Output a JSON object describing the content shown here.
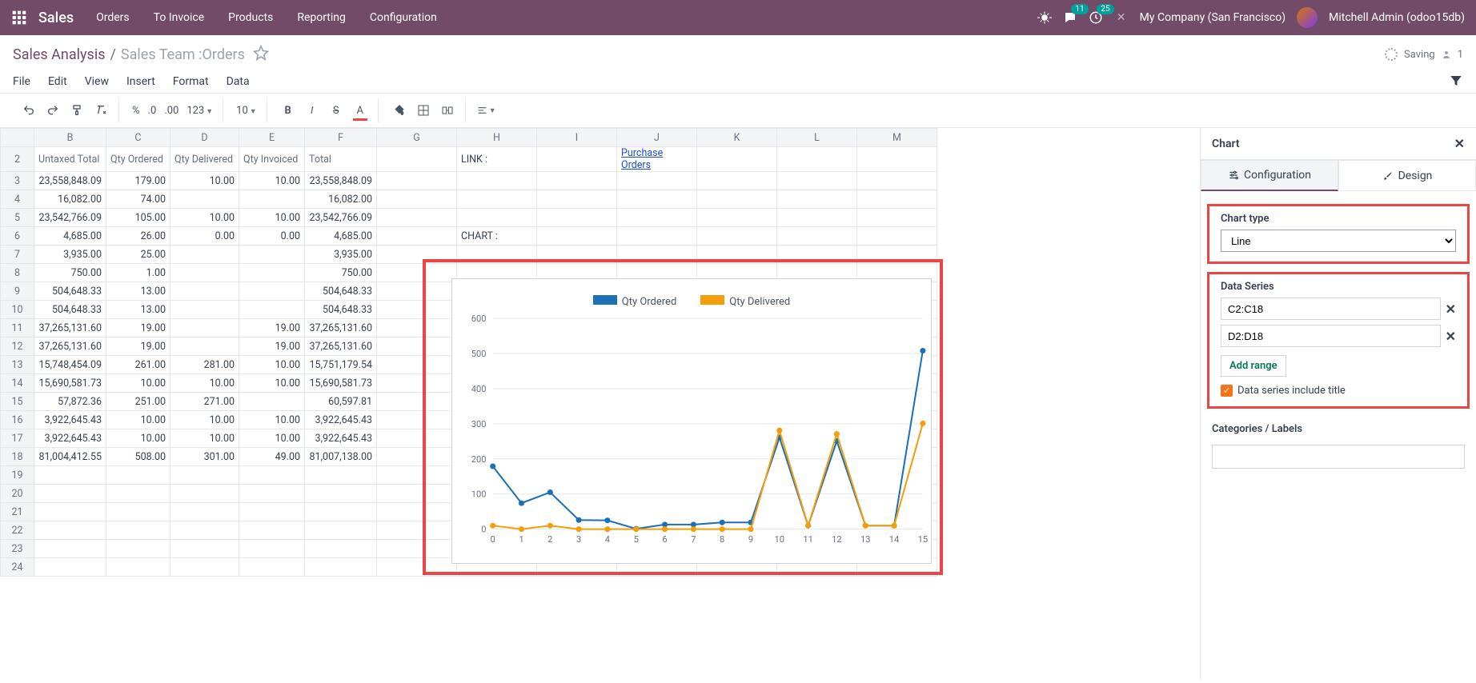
{
  "topnav": {
    "brand": "Sales",
    "menu": [
      "Orders",
      "To Invoice",
      "Products",
      "Reporting",
      "Configuration"
    ],
    "msg_count": "11",
    "activity_count": "25",
    "company": "My Company (San Francisco)",
    "user": "Mitchell Admin (odoo15db)"
  },
  "breadcrumb": {
    "root": "Sales Analysis",
    "current": "Sales Team :Orders",
    "saving": "Saving",
    "users": "1"
  },
  "menubar": [
    "File",
    "Edit",
    "View",
    "Insert",
    "Format",
    "Data"
  ],
  "toolbar": {
    "percent": "%",
    "d0": ".0",
    "d00": ".00",
    "n123": "123",
    "fontsize": "10",
    "bold": "B",
    "italic": "I",
    "strike": "S",
    "color": "A"
  },
  "sheet": {
    "col_letters": [
      "B",
      "C",
      "D",
      "E",
      "F",
      "G",
      "H",
      "I",
      "J",
      "K",
      "L",
      "M"
    ],
    "headers": [
      "Untaxed Total",
      "Qty Ordered",
      "Qty Delivered",
      "Qty Invoiced",
      "Total"
    ],
    "link_label": "LINK :",
    "link_text": "Purchase Orders",
    "chart_label": "CHART :",
    "rows": [
      {
        "n": 3,
        "c": [
          "23,558,848.09",
          "179.00",
          "10.00",
          "10.00",
          "23,558,848.09"
        ]
      },
      {
        "n": 4,
        "c": [
          "16,082.00",
          "74.00",
          "",
          "",
          "16,082.00"
        ]
      },
      {
        "n": 5,
        "c": [
          "23,542,766.09",
          "105.00",
          "10.00",
          "10.00",
          "23,542,766.09"
        ]
      },
      {
        "n": 6,
        "c": [
          "4,685.00",
          "26.00",
          "0.00",
          "0.00",
          "4,685.00"
        ]
      },
      {
        "n": 7,
        "c": [
          "3,935.00",
          "25.00",
          "",
          "",
          "3,935.00"
        ]
      },
      {
        "n": 8,
        "c": [
          "750.00",
          "1.00",
          "",
          "",
          "750.00"
        ]
      },
      {
        "n": 9,
        "c": [
          "504,648.33",
          "13.00",
          "",
          "",
          "504,648.33"
        ]
      },
      {
        "n": 10,
        "c": [
          "504,648.33",
          "13.00",
          "",
          "",
          "504,648.33"
        ]
      },
      {
        "n": 11,
        "c": [
          "37,265,131.60",
          "19.00",
          "",
          "19.00",
          "37,265,131.60"
        ]
      },
      {
        "n": 12,
        "c": [
          "37,265,131.60",
          "19.00",
          "",
          "19.00",
          "37,265,131.60"
        ]
      },
      {
        "n": 13,
        "c": [
          "15,748,454.09",
          "261.00",
          "281.00",
          "10.00",
          "15,751,179.54"
        ]
      },
      {
        "n": 14,
        "c": [
          "15,690,581.73",
          "10.00",
          "10.00",
          "10.00",
          "15,690,581.73"
        ]
      },
      {
        "n": 15,
        "c": [
          "57,872.36",
          "251.00",
          "271.00",
          "",
          "60,597.81"
        ]
      },
      {
        "n": 16,
        "c": [
          "3,922,645.43",
          "10.00",
          "10.00",
          "10.00",
          "3,922,645.43"
        ]
      },
      {
        "n": 17,
        "c": [
          "3,922,645.43",
          "10.00",
          "10.00",
          "10.00",
          "3,922,645.43"
        ]
      },
      {
        "n": 18,
        "c": [
          "81,004,412.55",
          "508.00",
          "301.00",
          "49.00",
          "81,007,138.00"
        ]
      }
    ],
    "empty_rows": [
      19,
      20,
      21,
      22,
      23,
      24
    ]
  },
  "chart_data": {
    "type": "line",
    "title": "",
    "xlabel": "",
    "ylabel": "",
    "ylim": [
      0,
      600
    ],
    "yticks": [
      0,
      100,
      200,
      300,
      400,
      500,
      600
    ],
    "x": [
      0,
      1,
      2,
      3,
      4,
      5,
      6,
      7,
      8,
      9,
      10,
      11,
      12,
      13,
      14,
      15
    ],
    "series": [
      {
        "name": "Qty Ordered",
        "color": "#1d6fb8",
        "values": [
          179,
          74,
          105,
          26,
          25,
          1,
          13,
          13,
          19,
          19,
          261,
          10,
          251,
          10,
          10,
          508
        ]
      },
      {
        "name": "Qty Delivered",
        "color": "#f59e0b",
        "values": [
          10,
          0,
          10,
          0,
          0,
          0,
          0,
          0,
          0,
          0,
          281,
          10,
          271,
          10,
          10,
          301
        ]
      }
    ]
  },
  "sidepanel": {
    "title": "Chart",
    "tab_config": "Configuration",
    "tab_design": "Design",
    "chart_type_label": "Chart type",
    "chart_type_value": "Line",
    "data_series_label": "Data Series",
    "series": [
      "C2:C18",
      "D2:D18"
    ],
    "add_range": "Add range",
    "include_title": "Data series include title",
    "categories_label": "Categories / Labels"
  }
}
